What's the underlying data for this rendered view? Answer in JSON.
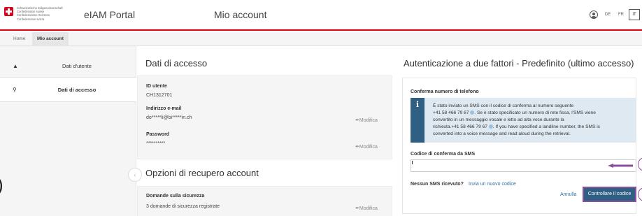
{
  "header": {
    "confederation_lines": [
      "Schweizerische Eidgenossenschaft",
      "Confédération suisse",
      "Confederazione Svizzera",
      "Confederaziun svizra"
    ],
    "portal_title": "eIAM Portal",
    "page_title": "Mio account",
    "languages": [
      "DE",
      "FR",
      "IT"
    ],
    "active_language": "IT"
  },
  "breadcrumb": {
    "home": "Home",
    "current": "Mio account"
  },
  "sidebar": {
    "items": [
      {
        "label": "Dati d'utente",
        "icon": "user-icon"
      },
      {
        "label": "Dati di accesso",
        "icon": "key-icon",
        "active": true
      }
    ]
  },
  "access_data": {
    "title": "Dati di accesso",
    "user_id_label": "ID utente",
    "user_id_value": "CH1312701",
    "email_label": "Indirizzo e-mail",
    "email_value": "do*****li@bi*****in.ch",
    "password_label": "Password",
    "password_value": "**********",
    "edit_label": "Modifica"
  },
  "recovery": {
    "title": "Opzioni di recupero account",
    "questions_label": "Domande sulla sicurezza",
    "questions_value": "3 domande di sicurezza registrate",
    "edit_label": "Modifica"
  },
  "mfa": {
    "title": "Autenticazione a due fattori - Predefinito (ultimo accesso)",
    "confirm_phone_heading": "Conferma numero di telefono",
    "info_line1": "È stato inviato un SMS con il codice di conferma al numero seguente",
    "info_line2_a": "+41 58 466 79 67",
    "info_line2_b": ". Se è stato specificato un numero di rete fissa, l'SMS viene",
    "info_line3": "convertito in un messaggio vocale e letto ad alta voce durante la",
    "info_line4_a": "richiesta.+41 58 466 79 67",
    "info_line4_b": ". If you have specified a landline number, the SMS is",
    "info_line5": "converted into a voice message and read aloud during the retrieval.",
    "code_label": "Codice di conferma da SMS",
    "code_value": "",
    "no_sms_label": "Nessun SMS ricevuto?",
    "resend_link": "Invia un nuovo codice",
    "cancel_label": "Annulla",
    "confirm_button": "Controllare il codice"
  },
  "colors": {
    "brand_red": "#dc0018",
    "primary_blue": "#2f5f83",
    "annotation_purple": "#8c4f9f",
    "info_bg": "#dfe9f1"
  }
}
